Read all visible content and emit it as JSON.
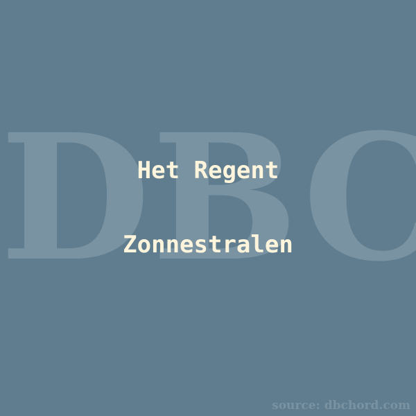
{
  "colors": {
    "background": "#5F7D8F",
    "watermark": "#7A93A2",
    "title": "#FFF5DC",
    "source": "#7A93A2"
  },
  "watermark": {
    "text": "DBC"
  },
  "title": {
    "line1": "Het Regent",
    "line2": "Zonnestralen"
  },
  "source": {
    "text": "source: dbchord.com"
  }
}
